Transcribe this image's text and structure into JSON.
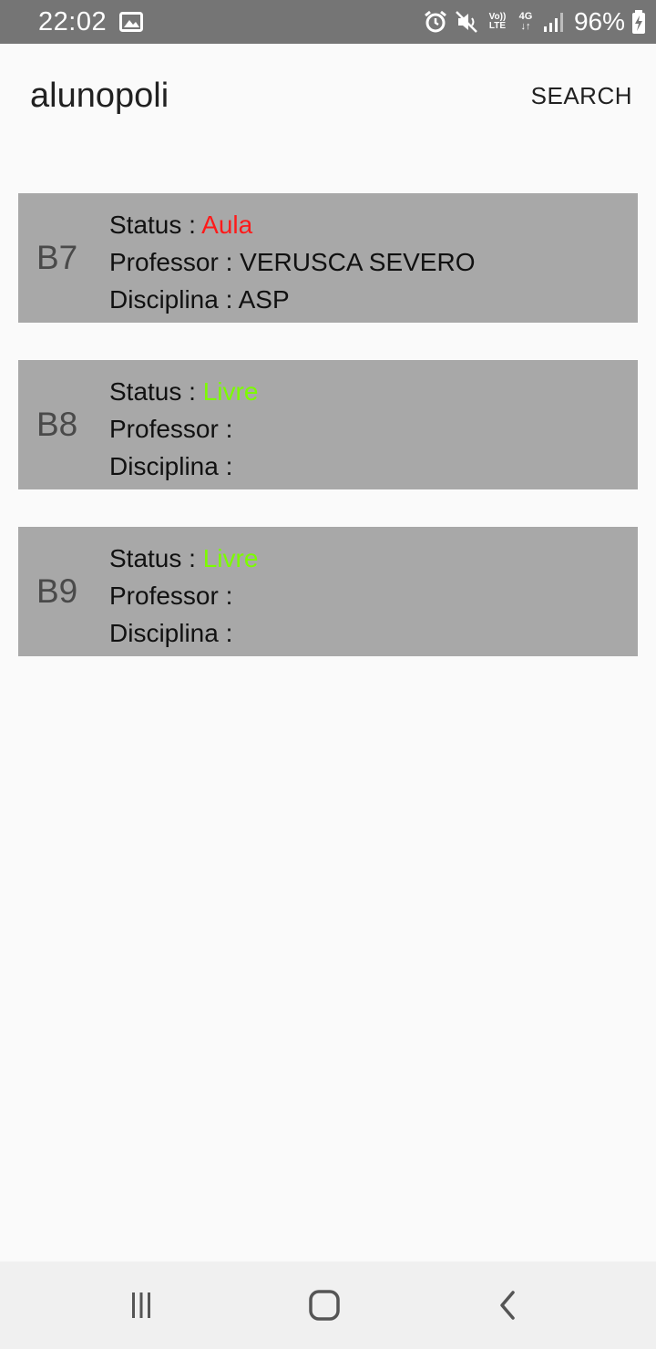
{
  "status_bar": {
    "time": "22:02",
    "lte_top": "Vo))",
    "lte_bottom": "LTE",
    "net_top": "4G",
    "net_bottom": "↓↑",
    "battery": "96%"
  },
  "app_bar": {
    "title": "alunopoli",
    "search_label": "SEARCH"
  },
  "labels": {
    "status": "Status : ",
    "professor": "Professor : ",
    "disciplina": "Disciplina : "
  },
  "rooms": [
    {
      "code": "B7",
      "status": "Aula",
      "status_color": "#ff1a1a",
      "professor": "VERUSCA SEVERO",
      "disciplina": "ASP"
    },
    {
      "code": "B8",
      "status": "Livre",
      "status_color": "#7cfc00",
      "professor": "",
      "disciplina": ""
    },
    {
      "code": "B9",
      "status": "Livre",
      "status_color": "#7cfc00",
      "professor": "",
      "disciplina": ""
    }
  ],
  "nav": {
    "icons": [
      "recent-apps-icon",
      "home-icon",
      "back-icon"
    ]
  }
}
